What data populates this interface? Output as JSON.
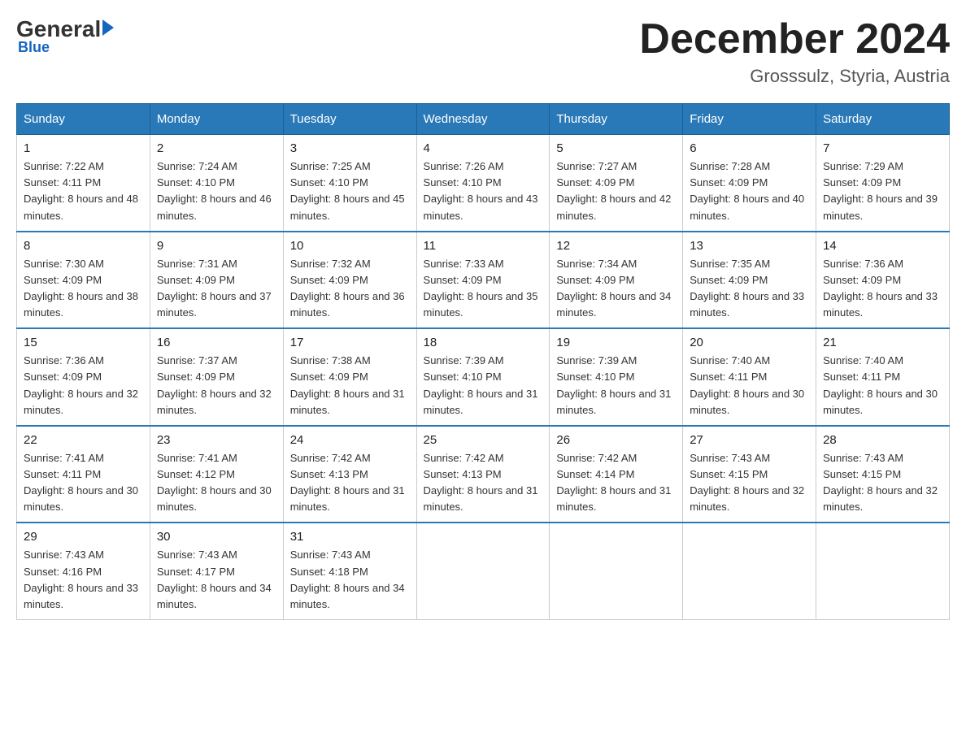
{
  "header": {
    "logo": {
      "general": "General",
      "blue": "Blue",
      "underline": "Blue"
    },
    "title": "December 2024",
    "location": "Grosssulz, Styria, Austria"
  },
  "weekdays": [
    "Sunday",
    "Monday",
    "Tuesday",
    "Wednesday",
    "Thursday",
    "Friday",
    "Saturday"
  ],
  "weeks": [
    [
      {
        "day": "1",
        "sunrise": "7:22 AM",
        "sunset": "4:11 PM",
        "daylight": "8 hours and 48 minutes."
      },
      {
        "day": "2",
        "sunrise": "7:24 AM",
        "sunset": "4:10 PM",
        "daylight": "8 hours and 46 minutes."
      },
      {
        "day": "3",
        "sunrise": "7:25 AM",
        "sunset": "4:10 PM",
        "daylight": "8 hours and 45 minutes."
      },
      {
        "day": "4",
        "sunrise": "7:26 AM",
        "sunset": "4:10 PM",
        "daylight": "8 hours and 43 minutes."
      },
      {
        "day": "5",
        "sunrise": "7:27 AM",
        "sunset": "4:09 PM",
        "daylight": "8 hours and 42 minutes."
      },
      {
        "day": "6",
        "sunrise": "7:28 AM",
        "sunset": "4:09 PM",
        "daylight": "8 hours and 40 minutes."
      },
      {
        "day": "7",
        "sunrise": "7:29 AM",
        "sunset": "4:09 PM",
        "daylight": "8 hours and 39 minutes."
      }
    ],
    [
      {
        "day": "8",
        "sunrise": "7:30 AM",
        "sunset": "4:09 PM",
        "daylight": "8 hours and 38 minutes."
      },
      {
        "day": "9",
        "sunrise": "7:31 AM",
        "sunset": "4:09 PM",
        "daylight": "8 hours and 37 minutes."
      },
      {
        "day": "10",
        "sunrise": "7:32 AM",
        "sunset": "4:09 PM",
        "daylight": "8 hours and 36 minutes."
      },
      {
        "day": "11",
        "sunrise": "7:33 AM",
        "sunset": "4:09 PM",
        "daylight": "8 hours and 35 minutes."
      },
      {
        "day": "12",
        "sunrise": "7:34 AM",
        "sunset": "4:09 PM",
        "daylight": "8 hours and 34 minutes."
      },
      {
        "day": "13",
        "sunrise": "7:35 AM",
        "sunset": "4:09 PM",
        "daylight": "8 hours and 33 minutes."
      },
      {
        "day": "14",
        "sunrise": "7:36 AM",
        "sunset": "4:09 PM",
        "daylight": "8 hours and 33 minutes."
      }
    ],
    [
      {
        "day": "15",
        "sunrise": "7:36 AM",
        "sunset": "4:09 PM",
        "daylight": "8 hours and 32 minutes."
      },
      {
        "day": "16",
        "sunrise": "7:37 AM",
        "sunset": "4:09 PM",
        "daylight": "8 hours and 32 minutes."
      },
      {
        "day": "17",
        "sunrise": "7:38 AM",
        "sunset": "4:09 PM",
        "daylight": "8 hours and 31 minutes."
      },
      {
        "day": "18",
        "sunrise": "7:39 AM",
        "sunset": "4:10 PM",
        "daylight": "8 hours and 31 minutes."
      },
      {
        "day": "19",
        "sunrise": "7:39 AM",
        "sunset": "4:10 PM",
        "daylight": "8 hours and 31 minutes."
      },
      {
        "day": "20",
        "sunrise": "7:40 AM",
        "sunset": "4:11 PM",
        "daylight": "8 hours and 30 minutes."
      },
      {
        "day": "21",
        "sunrise": "7:40 AM",
        "sunset": "4:11 PM",
        "daylight": "8 hours and 30 minutes."
      }
    ],
    [
      {
        "day": "22",
        "sunrise": "7:41 AM",
        "sunset": "4:11 PM",
        "daylight": "8 hours and 30 minutes."
      },
      {
        "day": "23",
        "sunrise": "7:41 AM",
        "sunset": "4:12 PM",
        "daylight": "8 hours and 30 minutes."
      },
      {
        "day": "24",
        "sunrise": "7:42 AM",
        "sunset": "4:13 PM",
        "daylight": "8 hours and 31 minutes."
      },
      {
        "day": "25",
        "sunrise": "7:42 AM",
        "sunset": "4:13 PM",
        "daylight": "8 hours and 31 minutes."
      },
      {
        "day": "26",
        "sunrise": "7:42 AM",
        "sunset": "4:14 PM",
        "daylight": "8 hours and 31 minutes."
      },
      {
        "day": "27",
        "sunrise": "7:43 AM",
        "sunset": "4:15 PM",
        "daylight": "8 hours and 32 minutes."
      },
      {
        "day": "28",
        "sunrise": "7:43 AM",
        "sunset": "4:15 PM",
        "daylight": "8 hours and 32 minutes."
      }
    ],
    [
      {
        "day": "29",
        "sunrise": "7:43 AM",
        "sunset": "4:16 PM",
        "daylight": "8 hours and 33 minutes."
      },
      {
        "day": "30",
        "sunrise": "7:43 AM",
        "sunset": "4:17 PM",
        "daylight": "8 hours and 34 minutes."
      },
      {
        "day": "31",
        "sunrise": "7:43 AM",
        "sunset": "4:18 PM",
        "daylight": "8 hours and 34 minutes."
      },
      null,
      null,
      null,
      null
    ]
  ]
}
